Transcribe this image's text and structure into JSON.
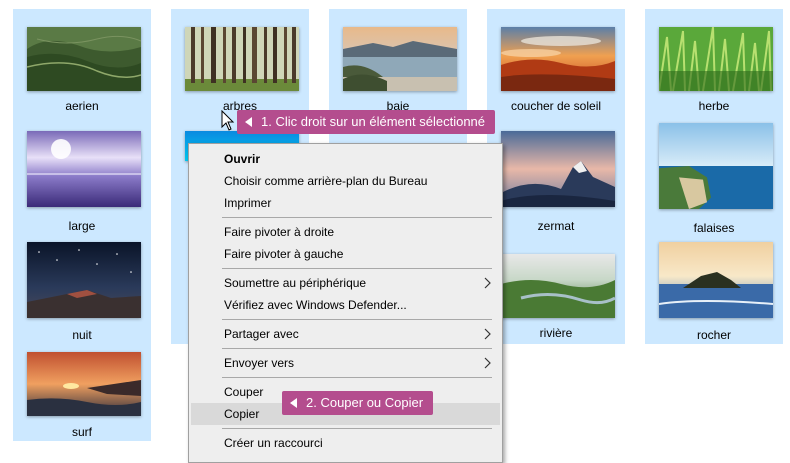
{
  "files": [
    {
      "label": "aerien",
      "thumb": "aerial-valley-thumbnail"
    },
    {
      "label": "arbres",
      "thumb": "forest-trees-thumbnail"
    },
    {
      "label": "baie",
      "thumb": "bay-coast-thumbnail"
    },
    {
      "label": "coucher de soleil",
      "thumb": "sunset-clouds-thumbnail"
    },
    {
      "label": "herbe",
      "thumb": "green-grass-thumbnail"
    },
    {
      "label": "large",
      "thumb": "purple-sea-thumbnail"
    },
    {
      "label": "",
      "thumb": "blue-underwater-thumbnail"
    },
    {
      "label": "",
      "thumb": "hidden-thumbnail"
    },
    {
      "label": "zermat",
      "thumb": "matterhorn-thumbnail"
    },
    {
      "label": "falaises",
      "thumb": "cliffs-coast-thumbnail"
    },
    {
      "label": "nuit",
      "thumb": "night-sky-thumbnail"
    },
    {
      "label": "",
      "thumb": "hidden-thumbnail"
    },
    {
      "label": "",
      "thumb": "hidden-thumbnail"
    },
    {
      "label": "rivière",
      "thumb": "river-valley-thumbnail"
    },
    {
      "label": "rocher",
      "thumb": "rock-sunset-thumbnail"
    },
    {
      "label": "surf",
      "thumb": "surf-sunset-thumbnail"
    }
  ],
  "context_menu": {
    "items": [
      {
        "label": "Ouvrir"
      },
      {
        "label": "Choisir comme arrière-plan du Bureau"
      },
      {
        "label": "Imprimer"
      },
      {
        "label": "Faire pivoter à droite"
      },
      {
        "label": "Faire pivoter à gauche"
      },
      {
        "label": "Soumettre au périphérique"
      },
      {
        "label": "Vérifiez avec Windows Defender..."
      },
      {
        "label": "Partager avec"
      },
      {
        "label": "Envoyer vers"
      },
      {
        "label": "Couper"
      },
      {
        "label": "Copier"
      },
      {
        "label": "Créer un raccourci"
      }
    ]
  },
  "callouts": {
    "step1": "1. Clic droit sur un élément sélectionné",
    "step2": "2. Couper ou Copier"
  },
  "colors": {
    "selection": "#cce8ff",
    "menu_bg": "#eeeeee",
    "menu_highlight": "#d9d9d9",
    "callout": "#b44d8e"
  }
}
